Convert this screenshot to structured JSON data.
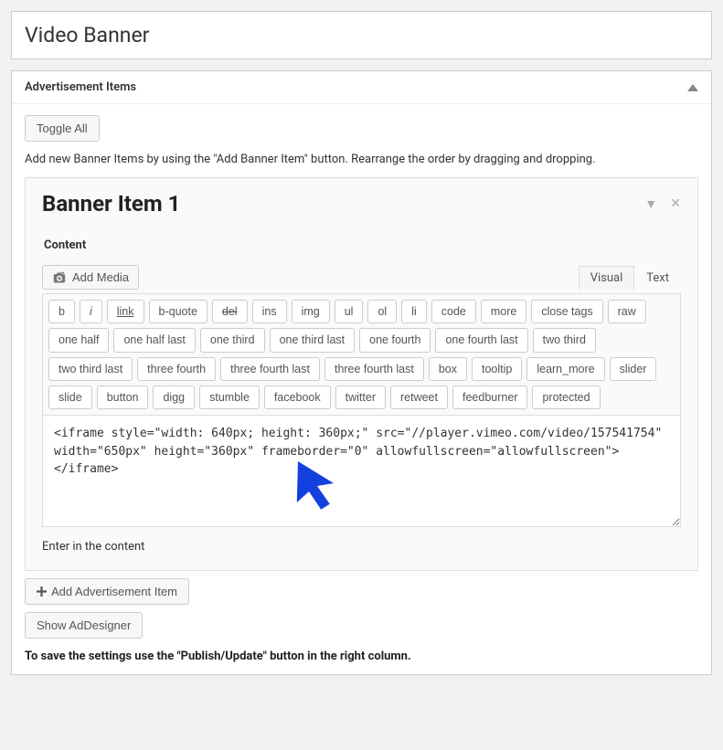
{
  "page": {
    "title": "Video Banner"
  },
  "section": {
    "title": "Advertisement Items",
    "toggle_all": "Toggle All",
    "instructions": "Add new Banner Items by using the \"Add Banner Item\" button. Rearrange the order by dragging and dropping."
  },
  "bannerItem": {
    "title": "Banner Item 1",
    "content_label": "Content",
    "add_media": "Add Media",
    "tabs": {
      "visual": "Visual",
      "text": "Text"
    },
    "quicktags": [
      "b",
      "i",
      "link",
      "b-quote",
      "del",
      "ins",
      "img",
      "ul",
      "ol",
      "li",
      "code",
      "more",
      "close tags",
      "raw",
      "one half",
      "one half last",
      "one third",
      "one third last",
      "one fourth",
      "one fourth last",
      "two third",
      "two third last",
      "three fourth",
      "three fourth last",
      "three fourth last",
      "box",
      "tooltip",
      "learn_more",
      "slider",
      "slide",
      "button",
      "digg",
      "stumble",
      "facebook",
      "twitter",
      "retweet",
      "feedburner",
      "protected"
    ],
    "textarea_value": "<iframe style=\"width: 640px; height: 360px;\" src=\"//player.vimeo.com/video/157541754\" width=\"650px\" height=\"360px\" frameborder=\"0\" allowfullscreen=\"allowfullscreen\"></iframe>",
    "hint": "Enter in the content"
  },
  "footer": {
    "add_item": "Add Advertisement Item",
    "show_addesigner": "Show AdDesigner",
    "save_note": "To save the settings use the \"Publish/Update\" button in the right column."
  }
}
